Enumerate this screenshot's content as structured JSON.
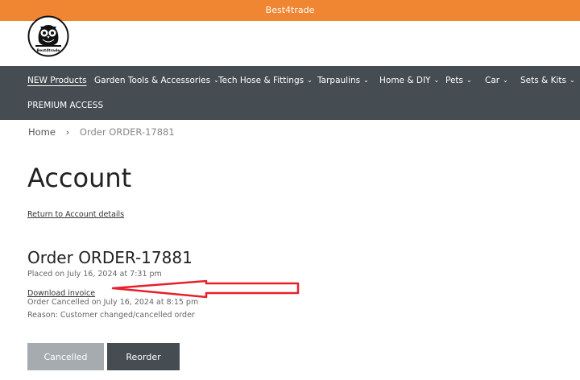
{
  "banner": {
    "title": "Best4trade"
  },
  "logo": {
    "alt_text": "Best4trade"
  },
  "nav": {
    "items": [
      {
        "label": "NEW Products",
        "has_dropdown": false
      },
      {
        "label": "Garden Tools & Accessories",
        "has_dropdown": true
      },
      {
        "label": "Tech Hose & Fittings",
        "has_dropdown": true
      },
      {
        "label": "Tarpaulins",
        "has_dropdown": true
      },
      {
        "label": "Home & DIY",
        "has_dropdown": true
      },
      {
        "label": "Pets",
        "has_dropdown": true
      },
      {
        "label": "Car",
        "has_dropdown": true
      },
      {
        "label": "Sets & Kits",
        "has_dropdown": true
      },
      {
        "label": "PREMIUM ACCESS",
        "has_dropdown": false
      }
    ],
    "chevron": "⌄"
  },
  "breadcrumb": {
    "home": "Home",
    "separator": "›",
    "current": "Order ORDER-17881"
  },
  "account": {
    "title": "Account",
    "return_link": "Return to Account details"
  },
  "order": {
    "title": "Order ORDER-17881",
    "placed": "Placed on July 16, 2024 at 7:31 pm",
    "download_invoice": "Download invoice",
    "cancelled_on": "Order Cancelled on July 16, 2024 at 8:15 pm",
    "reason": "Reason: Customer changed/cancelled order"
  },
  "buttons": {
    "cancelled": "Cancelled",
    "reorder": "Reorder"
  },
  "colors": {
    "banner": "#f08532",
    "nav": "#454c52",
    "button_disabled": "#a6abaf",
    "button_dark": "#454c52",
    "annotation_arrow": "#e8202a"
  }
}
